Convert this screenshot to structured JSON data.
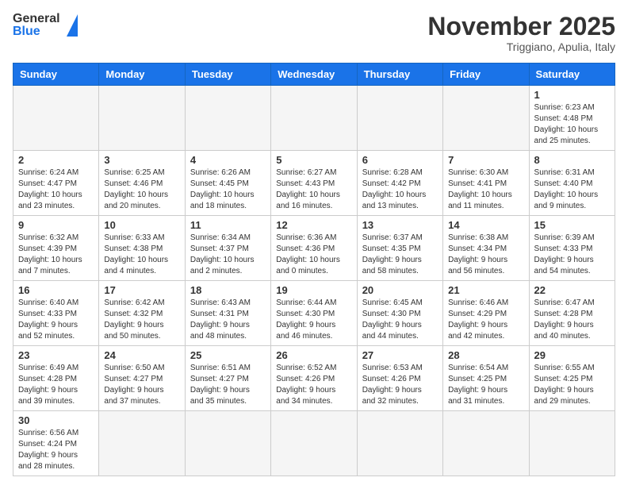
{
  "header": {
    "logo_general": "General",
    "logo_blue": "Blue",
    "month_title": "November 2025",
    "location": "Triggiano, Apulia, Italy"
  },
  "weekdays": [
    "Sunday",
    "Monday",
    "Tuesday",
    "Wednesday",
    "Thursday",
    "Friday",
    "Saturday"
  ],
  "days": {
    "d1": {
      "num": "1",
      "info": "Sunrise: 6:23 AM\nSunset: 4:48 PM\nDaylight: 10 hours\nand 25 minutes."
    },
    "d2": {
      "num": "2",
      "info": "Sunrise: 6:24 AM\nSunset: 4:47 PM\nDaylight: 10 hours\nand 23 minutes."
    },
    "d3": {
      "num": "3",
      "info": "Sunrise: 6:25 AM\nSunset: 4:46 PM\nDaylight: 10 hours\nand 20 minutes."
    },
    "d4": {
      "num": "4",
      "info": "Sunrise: 6:26 AM\nSunset: 4:45 PM\nDaylight: 10 hours\nand 18 minutes."
    },
    "d5": {
      "num": "5",
      "info": "Sunrise: 6:27 AM\nSunset: 4:43 PM\nDaylight: 10 hours\nand 16 minutes."
    },
    "d6": {
      "num": "6",
      "info": "Sunrise: 6:28 AM\nSunset: 4:42 PM\nDaylight: 10 hours\nand 13 minutes."
    },
    "d7": {
      "num": "7",
      "info": "Sunrise: 6:30 AM\nSunset: 4:41 PM\nDaylight: 10 hours\nand 11 minutes."
    },
    "d8": {
      "num": "8",
      "info": "Sunrise: 6:31 AM\nSunset: 4:40 PM\nDaylight: 10 hours\nand 9 minutes."
    },
    "d9": {
      "num": "9",
      "info": "Sunrise: 6:32 AM\nSunset: 4:39 PM\nDaylight: 10 hours\nand 7 minutes."
    },
    "d10": {
      "num": "10",
      "info": "Sunrise: 6:33 AM\nSunset: 4:38 PM\nDaylight: 10 hours\nand 4 minutes."
    },
    "d11": {
      "num": "11",
      "info": "Sunrise: 6:34 AM\nSunset: 4:37 PM\nDaylight: 10 hours\nand 2 minutes."
    },
    "d12": {
      "num": "12",
      "info": "Sunrise: 6:36 AM\nSunset: 4:36 PM\nDaylight: 10 hours\nand 0 minutes."
    },
    "d13": {
      "num": "13",
      "info": "Sunrise: 6:37 AM\nSunset: 4:35 PM\nDaylight: 9 hours\nand 58 minutes."
    },
    "d14": {
      "num": "14",
      "info": "Sunrise: 6:38 AM\nSunset: 4:34 PM\nDaylight: 9 hours\nand 56 minutes."
    },
    "d15": {
      "num": "15",
      "info": "Sunrise: 6:39 AM\nSunset: 4:33 PM\nDaylight: 9 hours\nand 54 minutes."
    },
    "d16": {
      "num": "16",
      "info": "Sunrise: 6:40 AM\nSunset: 4:33 PM\nDaylight: 9 hours\nand 52 minutes."
    },
    "d17": {
      "num": "17",
      "info": "Sunrise: 6:42 AM\nSunset: 4:32 PM\nDaylight: 9 hours\nand 50 minutes."
    },
    "d18": {
      "num": "18",
      "info": "Sunrise: 6:43 AM\nSunset: 4:31 PM\nDaylight: 9 hours\nand 48 minutes."
    },
    "d19": {
      "num": "19",
      "info": "Sunrise: 6:44 AM\nSunset: 4:30 PM\nDaylight: 9 hours\nand 46 minutes."
    },
    "d20": {
      "num": "20",
      "info": "Sunrise: 6:45 AM\nSunset: 4:30 PM\nDaylight: 9 hours\nand 44 minutes."
    },
    "d21": {
      "num": "21",
      "info": "Sunrise: 6:46 AM\nSunset: 4:29 PM\nDaylight: 9 hours\nand 42 minutes."
    },
    "d22": {
      "num": "22",
      "info": "Sunrise: 6:47 AM\nSunset: 4:28 PM\nDaylight: 9 hours\nand 40 minutes."
    },
    "d23": {
      "num": "23",
      "info": "Sunrise: 6:49 AM\nSunset: 4:28 PM\nDaylight: 9 hours\nand 39 minutes."
    },
    "d24": {
      "num": "24",
      "info": "Sunrise: 6:50 AM\nSunset: 4:27 PM\nDaylight: 9 hours\nand 37 minutes."
    },
    "d25": {
      "num": "25",
      "info": "Sunrise: 6:51 AM\nSunset: 4:27 PM\nDaylight: 9 hours\nand 35 minutes."
    },
    "d26": {
      "num": "26",
      "info": "Sunrise: 6:52 AM\nSunset: 4:26 PM\nDaylight: 9 hours\nand 34 minutes."
    },
    "d27": {
      "num": "27",
      "info": "Sunrise: 6:53 AM\nSunset: 4:26 PM\nDaylight: 9 hours\nand 32 minutes."
    },
    "d28": {
      "num": "28",
      "info": "Sunrise: 6:54 AM\nSunset: 4:25 PM\nDaylight: 9 hours\nand 31 minutes."
    },
    "d29": {
      "num": "29",
      "info": "Sunrise: 6:55 AM\nSunset: 4:25 PM\nDaylight: 9 hours\nand 29 minutes."
    },
    "d30": {
      "num": "30",
      "info": "Sunrise: 6:56 AM\nSunset: 4:24 PM\nDaylight: 9 hours\nand 28 minutes."
    }
  }
}
